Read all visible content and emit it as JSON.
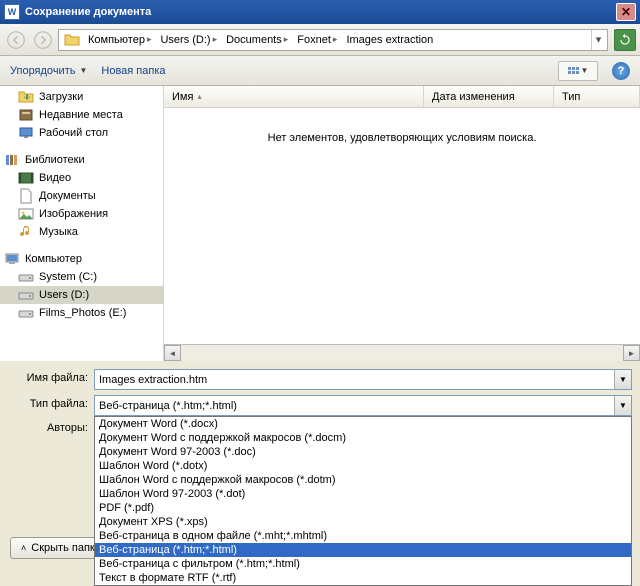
{
  "title": "Сохранение документа",
  "breadcrumbs": [
    "Компьютер",
    "Users (D:)",
    "Documents",
    "Foxnet",
    "Images extraction"
  ],
  "toolbar": {
    "organize": "Упорядочить",
    "newfolder": "Новая папка"
  },
  "sidebar": {
    "downloads": "Загрузки",
    "recent": "Недавние места",
    "desktop": "Рабочий стол",
    "libraries": "Библиотеки",
    "video": "Видео",
    "documents": "Документы",
    "images": "Изображения",
    "music": "Музыка",
    "computer": "Компьютер",
    "sysc": "System (C:)",
    "usersd": "Users (D:)",
    "films": "Films_Photos (E:)"
  },
  "columns": {
    "name": "Имя",
    "date": "Дата изменения",
    "type": "Тип"
  },
  "empty": "Нет элементов, удовлетворяющих условиям поиска.",
  "labels": {
    "filename": "Имя файла:",
    "filetype": "Тип файла:",
    "authors": "Авторы:"
  },
  "filename": "Images extraction.htm",
  "filetype_selected": "Веб-страница (*.htm;*.html)",
  "filetypes": [
    "Документ Word (*.docx)",
    "Документ Word с поддержкой макросов (*.docm)",
    "Документ Word 97-2003 (*.doc)",
    "Шаблон Word (*.dotx)",
    "Шаблон Word с поддержкой макросов (*.dotm)",
    "Шаблон Word 97-2003 (*.dot)",
    "PDF (*.pdf)",
    "Документ XPS (*.xps)",
    "Веб-страница в одном файле (*.mht;*.mhtml)",
    "Веб-страница (*.htm;*.html)",
    "Веб-страница с фильтром (*.htm;*.html)",
    "Текст в формате RTF (*.rtf)"
  ],
  "hide_folders": "Скрыть папки"
}
